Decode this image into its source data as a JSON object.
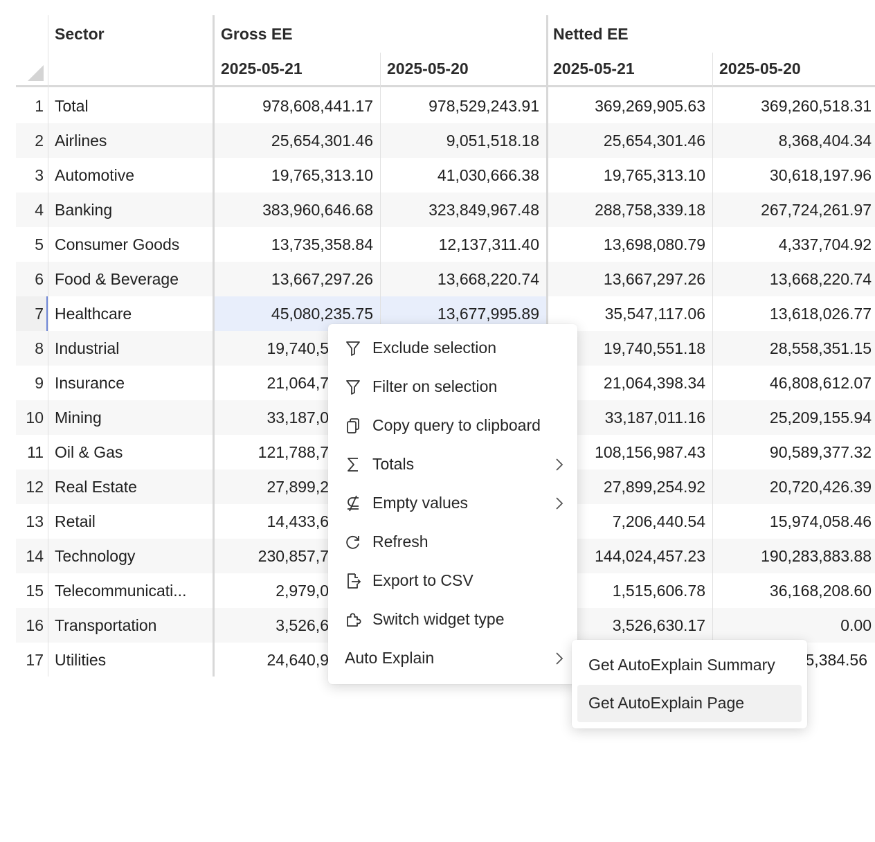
{
  "table": {
    "sector_header": "Sector",
    "group_headers": [
      "Gross EE",
      "Netted EE"
    ],
    "date_headers": [
      "2025-05-21",
      "2025-05-20",
      "2025-05-21",
      "2025-05-20"
    ],
    "rows": [
      {
        "num": "1",
        "sector": "Total",
        "values": [
          "978,608,441.17",
          "978,529,243.91",
          "369,269,905.63",
          "369,260,518.31"
        ]
      },
      {
        "num": "2",
        "sector": "Airlines",
        "values": [
          "25,654,301.46",
          "9,051,518.18",
          "25,654,301.46",
          "8,368,404.34"
        ]
      },
      {
        "num": "3",
        "sector": "Automotive",
        "values": [
          "19,765,313.10",
          "41,030,666.38",
          "19,765,313.10",
          "30,618,197.96"
        ]
      },
      {
        "num": "4",
        "sector": "Banking",
        "values": [
          "383,960,646.68",
          "323,849,967.48",
          "288,758,339.18",
          "267,724,261.97"
        ]
      },
      {
        "num": "5",
        "sector": "Consumer Goods",
        "values": [
          "13,735,358.84",
          "12,137,311.40",
          "13,698,080.79",
          "4,337,704.92"
        ]
      },
      {
        "num": "6",
        "sector": "Food & Beverage",
        "values": [
          "13,667,297.26",
          "13,668,220.74",
          "13,667,297.26",
          "13,668,220.74"
        ]
      },
      {
        "num": "7",
        "sector": "Healthcare",
        "values": [
          "45,080,235.75",
          "13,677,995.89",
          "35,547,117.06",
          "13,618,026.77"
        ]
      },
      {
        "num": "8",
        "sector": "Industrial",
        "values": [
          "19,740,5",
          "",
          "19,740,551.18",
          "28,558,351.15"
        ]
      },
      {
        "num": "9",
        "sector": "Insurance",
        "values": [
          "21,064,7",
          "",
          "21,064,398.34",
          "46,808,612.07"
        ]
      },
      {
        "num": "10",
        "sector": "Mining",
        "values": [
          "33,187,0",
          "",
          "33,187,011.16",
          "25,209,155.94"
        ]
      },
      {
        "num": "11",
        "sector": "Oil & Gas",
        "values": [
          "121,788,7",
          "",
          "108,156,987.43",
          "90,589,377.32"
        ]
      },
      {
        "num": "12",
        "sector": "Real Estate",
        "values": [
          "27,899,2",
          "",
          "27,899,254.92",
          "20,720,426.39"
        ]
      },
      {
        "num": "13",
        "sector": "Retail",
        "values": [
          "14,433,6",
          "",
          "7,206,440.54",
          "15,974,058.46"
        ]
      },
      {
        "num": "14",
        "sector": "Technology",
        "values": [
          "230,857,7",
          "",
          "144,024,457.23",
          "190,283,883.88"
        ]
      },
      {
        "num": "15",
        "sector": "Telecommunicati...",
        "values": [
          "2,979,0",
          "",
          "1,515,606.78",
          "36,168,208.60"
        ]
      },
      {
        "num": "16",
        "sector": "Transportation",
        "values": [
          "3,526,6",
          "",
          "3,526,630.17",
          "0.00"
        ]
      },
      {
        "num": "17",
        "sector": "Utilities",
        "values": [
          "24,640,9",
          "",
          "",
          "5,384.56"
        ]
      }
    ],
    "selected_row": "7"
  },
  "context_menu": {
    "items": [
      {
        "label": "Exclude selection",
        "icon": "filter-icon",
        "submenu": false
      },
      {
        "label": "Filter on selection",
        "icon": "filter-icon",
        "submenu": false
      },
      {
        "label": "Copy query to clipboard",
        "icon": "copy-icon",
        "submenu": false
      },
      {
        "label": "Totals",
        "icon": "sigma-icon",
        "submenu": true
      },
      {
        "label": "Empty values",
        "icon": "not-subset-icon",
        "submenu": true
      },
      {
        "label": "Refresh",
        "icon": "refresh-icon",
        "submenu": false
      },
      {
        "label": "Export to CSV",
        "icon": "export-file-icon",
        "submenu": false
      },
      {
        "label": "Switch widget type",
        "icon": "puzzle-icon",
        "submenu": false
      },
      {
        "label": "Auto Explain",
        "icon": "",
        "submenu": true
      }
    ]
  },
  "submenu": {
    "items": [
      {
        "label": "Get AutoExplain Summary"
      },
      {
        "label": "Get AutoExplain Page"
      }
    ],
    "hovered_index": 1
  },
  "colors": {
    "selection_bg": "#e8eefb",
    "selection_bar": "#6f86d6",
    "stripe_bg": "#f7f7f7"
  }
}
